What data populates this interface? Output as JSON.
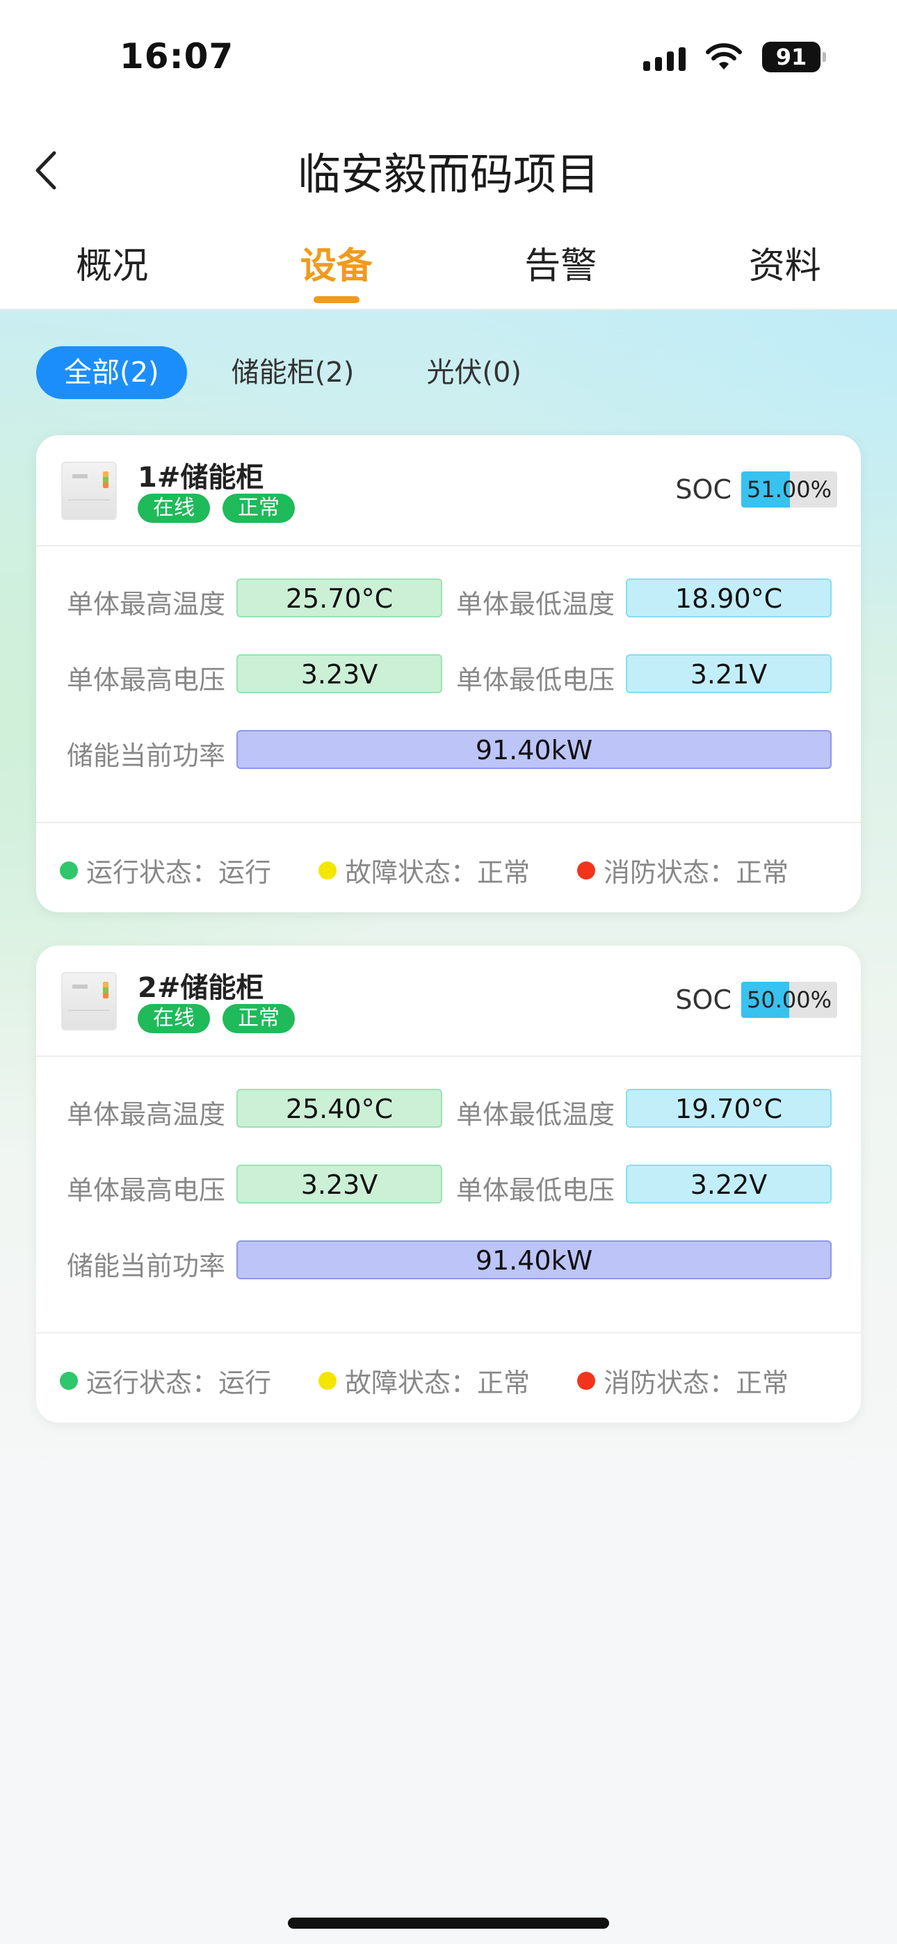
{
  "status_bar": {
    "time": "16:07",
    "battery": "91"
  },
  "nav": {
    "title": "临安毅而码项目"
  },
  "tabs": [
    {
      "label": "概况",
      "active": false
    },
    {
      "label": "设备",
      "active": true
    },
    {
      "label": "告警",
      "active": false
    },
    {
      "label": "资料",
      "active": false
    }
  ],
  "filters": [
    {
      "label": "全部(2)",
      "active": true
    },
    {
      "label": "储能柜(2)",
      "active": false
    },
    {
      "label": "光伏(0)",
      "active": false
    }
  ],
  "labels": {
    "soc": "SOC",
    "max_temp": "单体最高温度",
    "min_temp": "单体最低温度",
    "max_volt": "单体最高电压",
    "min_volt": "单体最低电压",
    "power": "储能当前功率",
    "run_status": "运行状态：",
    "fault_status": "故障状态：",
    "fire_status": "消防状态："
  },
  "colors": {
    "accent": "#f29a1b",
    "primary": "#1c8efb",
    "online": "#1fba59",
    "run_dot": "#2ec76b",
    "fault_dot": "#f3e600",
    "fire_dot": "#f2341c"
  },
  "cabinets": [
    {
      "name": "1#储能柜",
      "badges": [
        "在线",
        "正常"
      ],
      "soc_text": "51.00%",
      "soc": 0.51,
      "max_temp": "25.70°C",
      "min_temp": "18.90°C",
      "max_volt": "3.23V",
      "min_volt": "3.21V",
      "power": "91.40kW",
      "run": "运行",
      "fault": "正常",
      "fire": "正常"
    },
    {
      "name": "2#储能柜",
      "badges": [
        "在线",
        "正常"
      ],
      "soc_text": "50.00%",
      "soc": 0.5,
      "max_temp": "25.40°C",
      "min_temp": "19.70°C",
      "max_volt": "3.23V",
      "min_volt": "3.22V",
      "power": "91.40kW",
      "run": "运行",
      "fault": "正常",
      "fire": "正常"
    }
  ]
}
